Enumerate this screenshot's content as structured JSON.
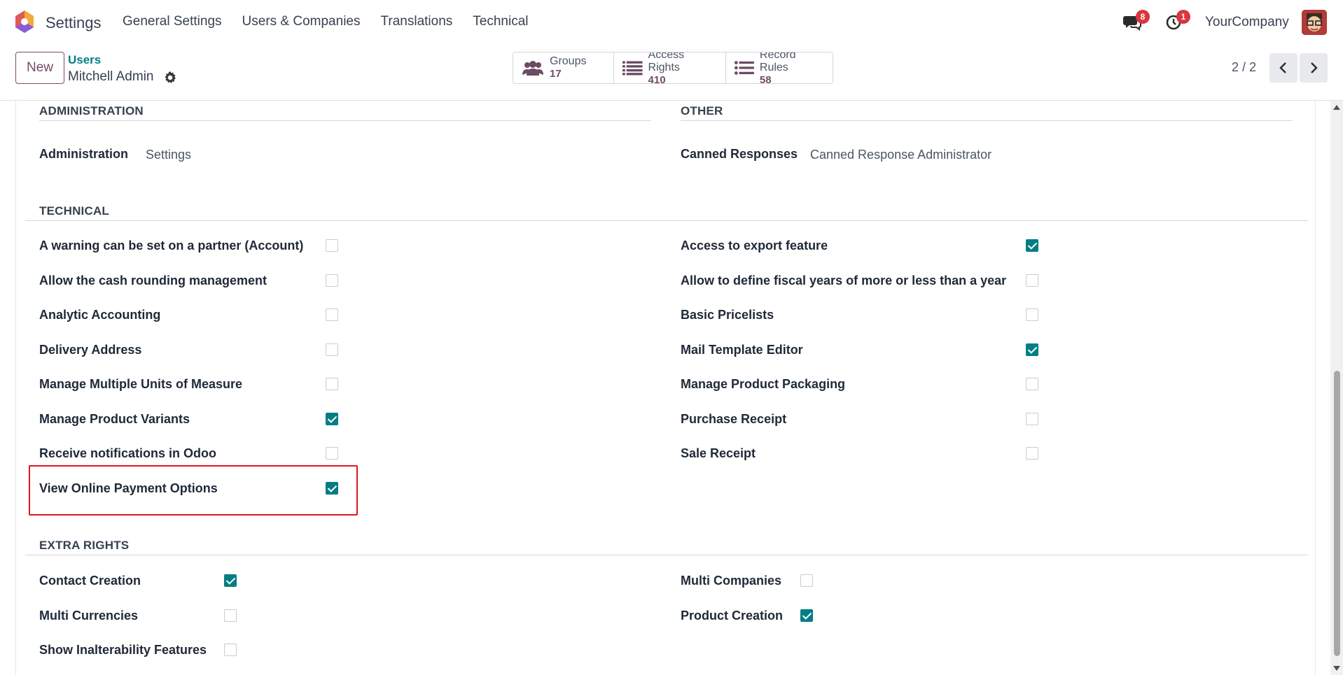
{
  "nav": {
    "app_title": "Settings",
    "menu": [
      "General Settings",
      "Users & Companies",
      "Translations",
      "Technical"
    ],
    "messages_badge": "8",
    "activities_badge": "1",
    "company": "YourCompany"
  },
  "control": {
    "new_label": "New",
    "breadcrumb_parent": "Users",
    "breadcrumb_current": "Mitchell Admin",
    "smart_buttons": [
      {
        "label": "Groups",
        "count": "17",
        "icon": "users-icon"
      },
      {
        "label": "Access Rights",
        "count": "410",
        "icon": "list-icon"
      },
      {
        "label": "Record Rules",
        "count": "58",
        "icon": "list-icon"
      }
    ],
    "pager": "2 / 2"
  },
  "sections": {
    "administration": {
      "title": "ADMINISTRATION",
      "label": "Administration",
      "value": "Settings"
    },
    "other": {
      "title": "OTHER",
      "label": "Canned Responses",
      "value": "Canned Response Administrator"
    },
    "technical": {
      "title": "TECHNICAL",
      "left": [
        {
          "label": "A warning can be set on a partner (Account)",
          "checked": false
        },
        {
          "label": "Allow the cash rounding management",
          "checked": false
        },
        {
          "label": "Analytic Accounting",
          "checked": false
        },
        {
          "label": "Delivery Address",
          "checked": false
        },
        {
          "label": "Manage Multiple Units of Measure",
          "checked": false
        },
        {
          "label": "Manage Product Variants",
          "checked": true
        },
        {
          "label": "Receive notifications in Odoo",
          "checked": false
        },
        {
          "label": "View Online Payment Options",
          "checked": true
        }
      ],
      "right": [
        {
          "label": "Access to export feature",
          "checked": true
        },
        {
          "label": "Allow to define fiscal years of more or less than a year",
          "checked": false
        },
        {
          "label": "Basic Pricelists",
          "checked": false
        },
        {
          "label": "Mail Template Editor",
          "checked": true
        },
        {
          "label": "Manage Product Packaging",
          "checked": false
        },
        {
          "label": "Purchase Receipt",
          "checked": false
        },
        {
          "label": "Sale Receipt",
          "checked": false
        }
      ]
    },
    "extra_rights": {
      "title": "EXTRA RIGHTS",
      "left": [
        {
          "label": "Contact Creation",
          "checked": true
        },
        {
          "label": "Multi Currencies",
          "checked": false
        },
        {
          "label": "Show Inalterability Features",
          "checked": false
        }
      ],
      "right": [
        {
          "label": "Multi Companies",
          "checked": false
        },
        {
          "label": "Product Creation",
          "checked": true
        }
      ]
    }
  },
  "colors": {
    "brand": "#714b67",
    "teal": "#017e84",
    "badge": "#d9363e",
    "highlight": "#e3161c"
  }
}
